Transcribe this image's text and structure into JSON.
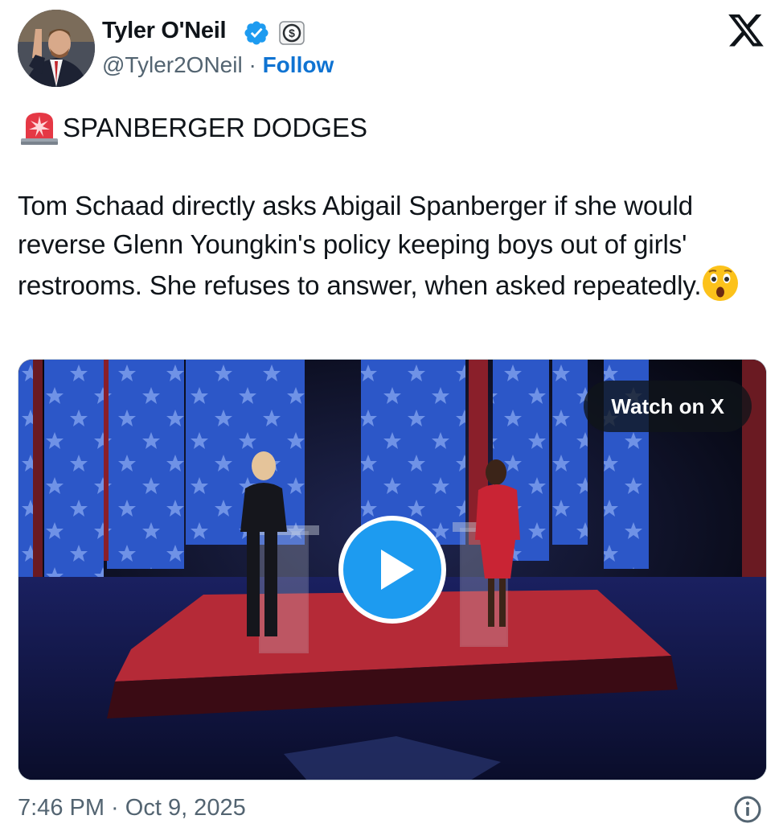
{
  "author": {
    "name": "Tyler O'Neil",
    "handle": "@Tyler2ONeil",
    "separator": "·",
    "follow_label": "Follow",
    "verified_icon": "verified-badge-icon",
    "subscription_icon": "dollar-badge-icon"
  },
  "post": {
    "headline_icon": "police-siren-emoji",
    "headline": "SPANBERGER DODGES",
    "body": "Tom Schaad directly asks Abigail Spanberger if she would reverse Glenn Youngkin's policy keeping boys out of girls' restrooms. She refuses to answer, when asked repeatedly.",
    "trailing_emoji": "astonished-face-emoji"
  },
  "media": {
    "watch_label": "Watch on X",
    "play_icon": "play-icon"
  },
  "footer": {
    "timestamp": "7:46 PM · Oct 9, 2025",
    "info_icon": "info-icon"
  },
  "colors": {
    "accent": "#1d9bf0",
    "follow": "#0f73d2",
    "secondary_text": "#536471",
    "stage_red": "#b52a37",
    "banner_blue": "#2c57c8"
  }
}
